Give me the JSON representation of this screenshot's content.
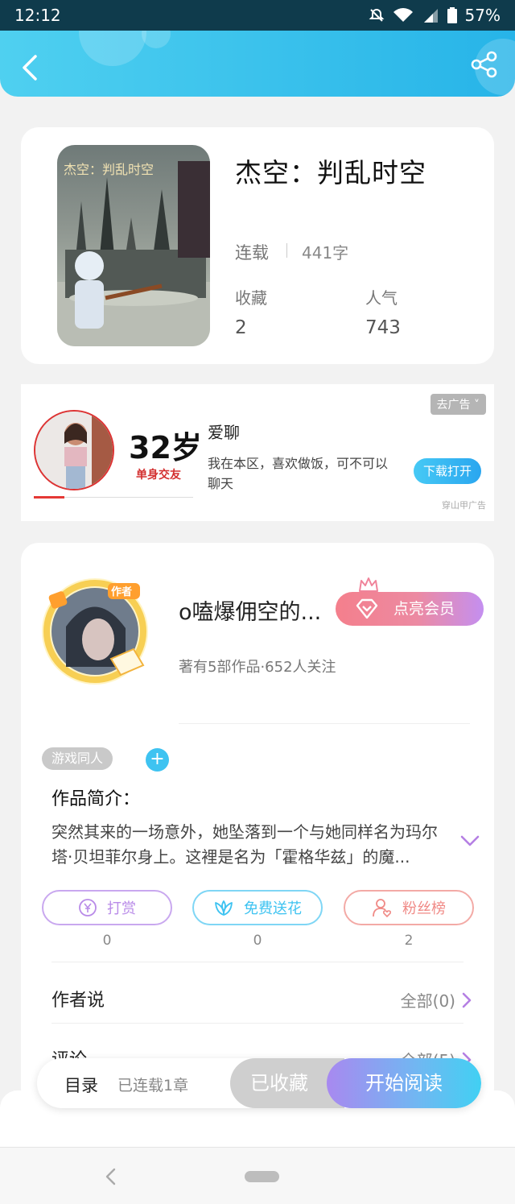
{
  "status_bar": {
    "time": "12:12",
    "battery": "57%"
  },
  "header": {
    "back_icon": "chevron-left-icon",
    "share_icon": "share-icon"
  },
  "book": {
    "title": "杰空：判乱时空",
    "status": "连载",
    "word_count": "441字",
    "favorites_label": "收藏",
    "favorites_value": "2",
    "popularity_label": "人气",
    "popularity_value": "743"
  },
  "ad": {
    "age": "32岁",
    "subtitle": "单身交友",
    "name": "爱聊",
    "description": "我在本区，喜欢做饭，可不可以聊天",
    "remove_label": "去广告",
    "download_label": "下载打开",
    "source": "穿山甲广告"
  },
  "author": {
    "badge": "作者",
    "name": "o嗑爆佣空的...",
    "vip_label": "点亮会员",
    "meta": "著有5部作品·652人关注"
  },
  "tags": [
    "游戏同人"
  ],
  "intro": {
    "title": "作品简介：",
    "text": "突然其来的一场意外，她坠落到一个与她同样名为玛尔塔·贝坦菲尔身上。这裡是名为「霍格华兹」的魔..."
  },
  "actions": [
    {
      "label": "打赏",
      "count": "0",
      "icon": "yuan-coin-icon",
      "color": "#b98be8"
    },
    {
      "label": "免费送花",
      "count": "0",
      "icon": "flower-icon",
      "color": "#3ec3f1"
    },
    {
      "label": "粉丝榜",
      "count": "2",
      "icon": "user-heart-icon",
      "color": "#f08a86"
    }
  ],
  "author_says": {
    "label": "作者说",
    "right": "全部(0)"
  },
  "comments": {
    "label": "评论",
    "right": "全部(5)"
  },
  "bottom_bar": {
    "toc_label": "目录",
    "chapters": "已连载1章",
    "collected_label": "已收藏",
    "read_label": "开始阅读"
  }
}
